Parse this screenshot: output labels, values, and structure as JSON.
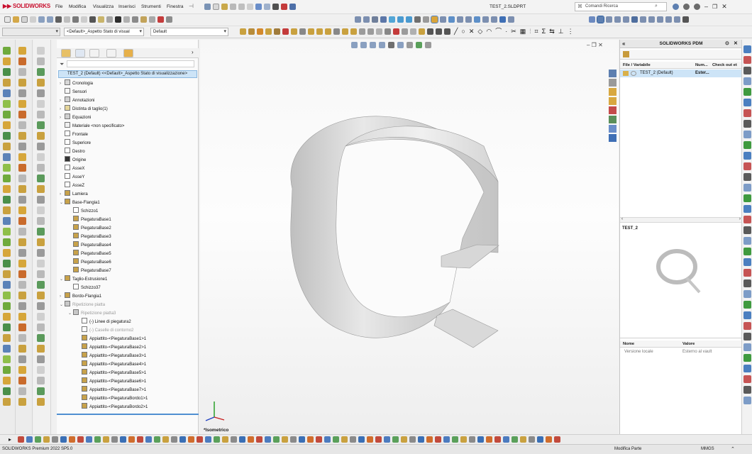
{
  "app": {
    "logo_main": "SOLIDWORKS",
    "title": "TEST_2.SLDPRT"
  },
  "menu": [
    "File",
    "Modifica",
    "Visualizza",
    "Inserisci",
    "Strumenti",
    "Finestra"
  ],
  "search": {
    "placeholder": "Comandi Ricerca"
  },
  "toolbar2": {
    "config_dropdown": "<Default>_Aspetto Stato di visual",
    "display_dropdown": "Default"
  },
  "feature_tree": {
    "root": "TEST_2 (Default) <<Default>_Aspetto Stato di visualizzazione>",
    "items": [
      {
        "label": "Cronologia",
        "dim": false
      },
      {
        "label": "Sensori",
        "dim": false
      },
      {
        "label": "Annotazioni",
        "dim": false
      },
      {
        "label": "Distinta di taglio(1)",
        "dim": false
      },
      {
        "label": "Equazioni",
        "dim": false
      },
      {
        "label": "Materiale <non specificato>",
        "dim": false
      },
      {
        "label": "Frontale",
        "dim": false
      },
      {
        "label": "Superiore",
        "dim": false
      },
      {
        "label": "Destro",
        "dim": false
      },
      {
        "label": "Origine",
        "dim": false
      },
      {
        "label": "AsseX",
        "dim": false
      },
      {
        "label": "AsseY",
        "dim": false
      },
      {
        "label": "AsseZ",
        "dim": false
      },
      {
        "label": "Lamiera",
        "dim": false
      },
      {
        "label": "Base-Flangia1",
        "dim": false
      },
      {
        "label": "Schizzo1",
        "dim": false
      },
      {
        "label": "PiegaturaBase1",
        "dim": false
      },
      {
        "label": "PiegaturaBase2",
        "dim": false
      },
      {
        "label": "PiegaturaBase3",
        "dim": false
      },
      {
        "label": "PiegaturaBase4",
        "dim": false
      },
      {
        "label": "PiegaturaBase5",
        "dim": false
      },
      {
        "label": "PiegaturaBase6",
        "dim": false
      },
      {
        "label": "PiegaturaBase7",
        "dim": false
      },
      {
        "label": "Taglio-Estrusione1",
        "dim": false
      },
      {
        "label": "Schizzo37",
        "dim": false
      },
      {
        "label": "Bordo-Flangia1",
        "dim": false
      },
      {
        "label": "Ripetizione piatta",
        "dim": true
      },
      {
        "label": "Ripetizione piatta3",
        "dim": true
      },
      {
        "label": "(-) Linee di piegatura2",
        "dim": false
      },
      {
        "label": "(-) Caselle di contorno2",
        "dim": true
      },
      {
        "label": "Appiattito-<PiegaturaBase1>1",
        "dim": false
      },
      {
        "label": "Appiattito-<PiegaturaBase2>1",
        "dim": false
      },
      {
        "label": "Appiattito-<PiegaturaBase3>1",
        "dim": false
      },
      {
        "label": "Appiattito-<PiegaturaBase4>1",
        "dim": false
      },
      {
        "label": "Appiattito-<PiegaturaBase5>1",
        "dim": false
      },
      {
        "label": "Appiattito-<PiegaturaBase6>1",
        "dim": false
      },
      {
        "label": "Appiattito-<PiegaturaBase7>1",
        "dim": false
      },
      {
        "label": "Appiattito-<PiegaturaBordo1>1",
        "dim": false
      },
      {
        "label": "Appiattito-<PiegaturaBordo2>1",
        "dim": false
      }
    ]
  },
  "viewport": {
    "view_label": "*Isometrico"
  },
  "pdm": {
    "title": "SOLIDWORKS PDM",
    "columns": [
      "File / Variabile",
      "Num...",
      "Check out et"
    ],
    "row": {
      "file": "TEST_2 (Default)",
      "num": "Ester..."
    },
    "preview_label": "TEST_2",
    "prop_columns": [
      "Nome",
      "Valore"
    ],
    "prop_row": {
      "name": "Versione locale",
      "value": "Esterno al vault"
    }
  },
  "status": {
    "left": "SOLIDWORKS Premium 2022 SP5.0",
    "mode": "Modifica Parte",
    "units": "MMGS"
  }
}
